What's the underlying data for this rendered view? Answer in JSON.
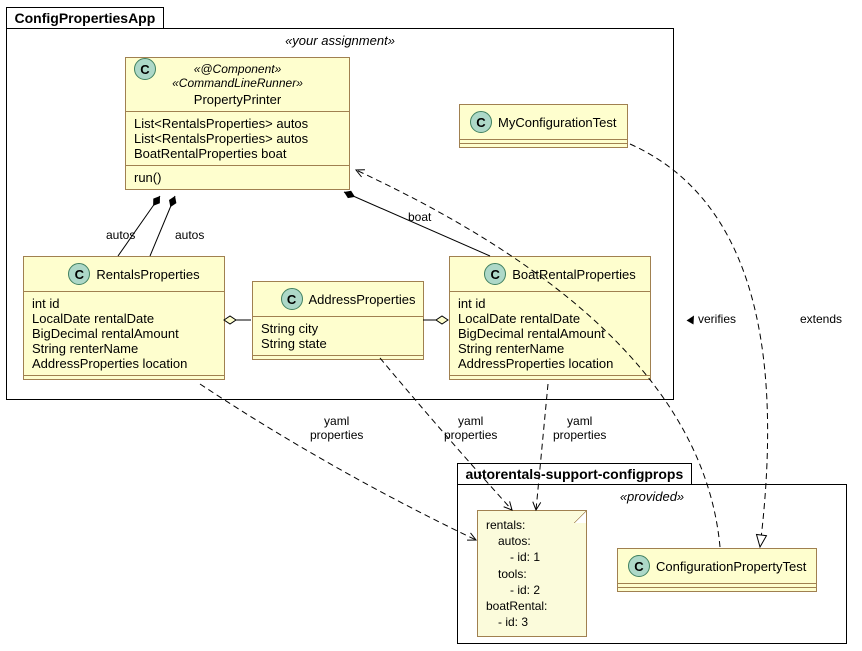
{
  "packages": {
    "main": {
      "title": "ConfigPropertiesApp",
      "stereo": "«your assignment»"
    },
    "support": {
      "title": "autorentals-support-configprops",
      "stereo": "«provided»"
    }
  },
  "classes": {
    "propertyPrinter": {
      "stereo1": "«@Component»",
      "stereo2": "«CommandLineRunner»",
      "name": "PropertyPrinter",
      "attrs": [
        "List<RentalsProperties> autos",
        "List<RentalsProperties> autos",
        "BoatRentalProperties boat"
      ],
      "ops": [
        "run()"
      ]
    },
    "myConfigTest": {
      "name": "MyConfigurationTest"
    },
    "rentalsProps": {
      "name": "RentalsProperties",
      "attrs": [
        "int id",
        "LocalDate rentalDate",
        "BigDecimal rentalAmount",
        "String renterName",
        "AddressProperties location"
      ]
    },
    "addressProps": {
      "name": "AddressProperties",
      "attrs": [
        "String city",
        "String state"
      ]
    },
    "boatRentalProps": {
      "name": "BoatRentalProperties",
      "attrs": [
        "int id",
        "LocalDate rentalDate",
        "BigDecimal rentalAmount",
        "String renterName",
        "AddressProperties location"
      ]
    },
    "configPropTest": {
      "name": "ConfigurationPropertyTest"
    }
  },
  "note": {
    "lines": [
      "rentals:",
      "  autos:",
      "    - id: 1",
      "  tools:",
      "    - id: 2",
      "boatRental:",
      "  - id: 3"
    ]
  },
  "labels": {
    "autos1": "autos",
    "autos2": "autos",
    "boat": "boat",
    "yamlProps": "yaml\nproperties",
    "verifies": "verifies",
    "extends": "extends"
  }
}
